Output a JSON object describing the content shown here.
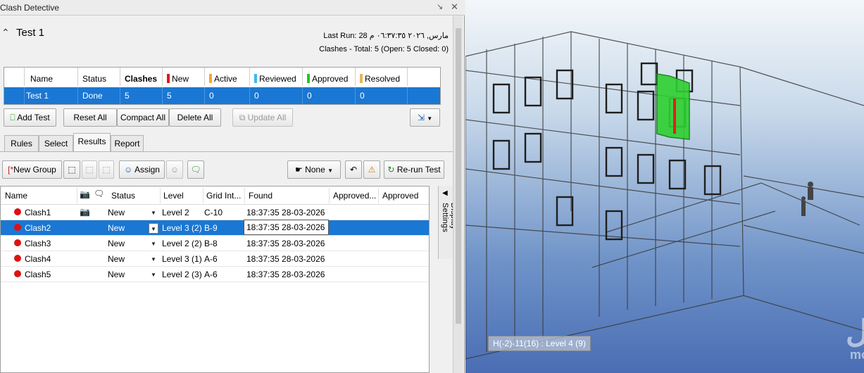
{
  "window": {
    "title": "Clash Detective",
    "pin_icon": "pin-icon",
    "close_icon": "close-icon"
  },
  "test": {
    "name": "Test 1",
    "last_run_label": "Last Run:",
    "last_run_value": "مارس, ٢٠٢٦ ٠٦:٣٧:٣٥ م 28",
    "summary": "Clashes - Total: 5 (Open: 5 Closed: 0)"
  },
  "test_table": {
    "headers": {
      "name": "Name",
      "status": "Status",
      "clashes": "Clashes",
      "new": "New",
      "active": "Active",
      "reviewed": "Reviewed",
      "approved": "Approved",
      "resolved": "Resolved"
    },
    "row": {
      "name": "Test 1",
      "status": "Done",
      "clashes": "5",
      "new": "5",
      "active": "0",
      "reviewed": "0",
      "approved": "0",
      "resolved": "0"
    },
    "colors": {
      "new": "#e01818",
      "active": "#f0a830",
      "reviewed": "#3cb8ef",
      "approved": "#22c81e",
      "resolved": "#e8b45c"
    }
  },
  "buttons": {
    "add_test": "Add Test",
    "reset_all": "Reset All",
    "compact_all": "Compact All",
    "delete_all": "Delete All",
    "update_all": "Update All"
  },
  "tabs": [
    "Rules",
    "Select",
    "Results",
    "Report"
  ],
  "toolbar": {
    "new_group": "New Group",
    "assign": "Assign",
    "filter": "None",
    "rerun": "Re-run Test"
  },
  "results": {
    "headers": {
      "name": "Name",
      "status": "Status",
      "level": "Level",
      "grid": "Grid Int...",
      "found": "Found",
      "approved_by": "Approved...",
      "approved": "Approved"
    },
    "rows": [
      {
        "name": "Clash1",
        "status": "New",
        "level": "Level 2",
        "grid": "C-10",
        "found": "18:37:35 28-03-2026"
      },
      {
        "name": "Clash2",
        "status": "New",
        "level": "Level 3 (2)",
        "grid": "B-9",
        "found": "18:37:35 28-03-2026"
      },
      {
        "name": "Clash3",
        "status": "New",
        "level": "Level 2 (2)",
        "grid": "B-8",
        "found": "18:37:35 28-03-2026"
      },
      {
        "name": "Clash4",
        "status": "New",
        "level": "Level 3 (1)",
        "grid": "A-6",
        "found": "18:37:35 28-03-2026"
      },
      {
        "name": "Clash5",
        "status": "New",
        "level": "Level 2 (3)",
        "grid": "A-6",
        "found": "18:37:35 28-03-2026"
      }
    ]
  },
  "display_settings": "Display Settings",
  "viewport": {
    "tooltip": "H(-2)-11(16) : Level 4 (9)",
    "watermark": "مستقل",
    "watermark_url": "mostaql.com"
  }
}
